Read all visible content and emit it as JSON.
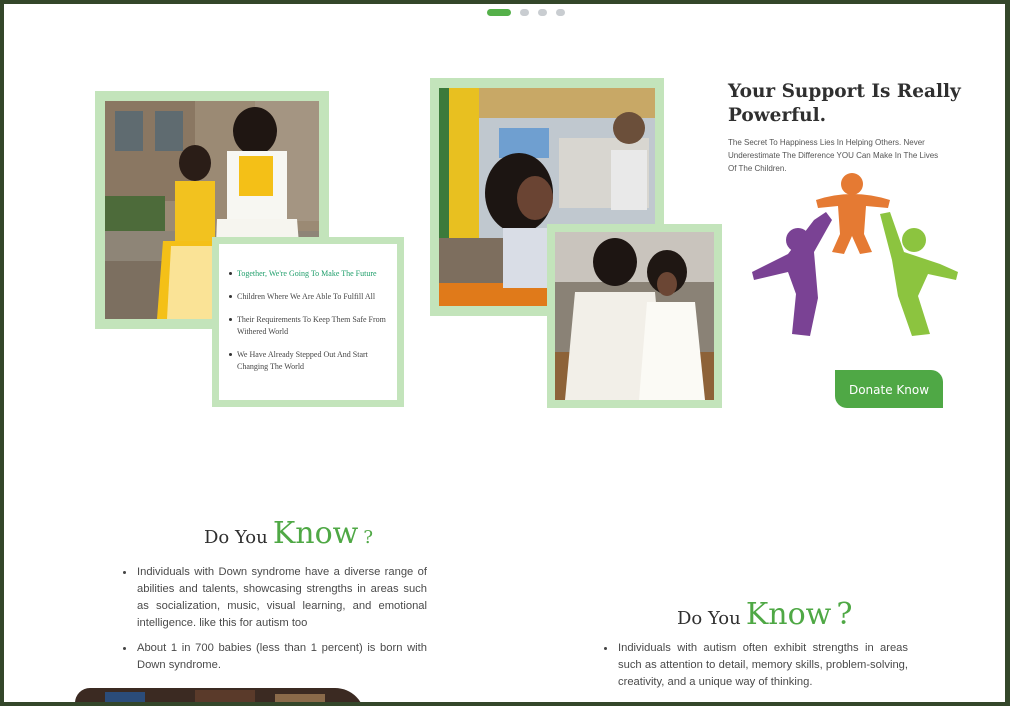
{
  "carousel": {
    "slide_count": 4,
    "active_index": 0
  },
  "features": {
    "items": [
      "Together, We're Going To Make The Future",
      "Children Where We Are Able To Fulfill All",
      "Their Requirements To Keep Them Safe From Withered World",
      "We Have Already Stepped Out And Start Changing The World"
    ]
  },
  "support": {
    "title": "Your Support Is Really Powerful.",
    "description": "The Secret To Happiness Lies In Helping Others. Never Underestimate The Difference YOU Can Make In The Lives Of The Children.",
    "donate_label": "Donate Know"
  },
  "know_left": {
    "prefix": "Do You",
    "emphasis": "Know",
    "suffix": "?",
    "facts": [
      "Individuals with Down syndrome have a diverse range of abilities and talents, showcasing strengths in areas such as socialization, music, visual learning, and emotional intelligence. like this for autism too",
      "About 1 in 700 babies (less than 1 percent) is born with Down syndrome."
    ]
  },
  "know_right": {
    "prefix": "Do You",
    "emphasis": "Know",
    "suffix": "?",
    "facts": [
      "Individuals with autism often exhibit strengths in areas such as attention to detail, memory skills, problem-solving, creativity, and a unique way of thinking."
    ]
  },
  "colors": {
    "accent": "#4fa845",
    "frame": "#c3e4bb",
    "figure_purple": "#7a4294",
    "figure_orange": "#e57a33",
    "figure_green": "#8cc43f"
  }
}
